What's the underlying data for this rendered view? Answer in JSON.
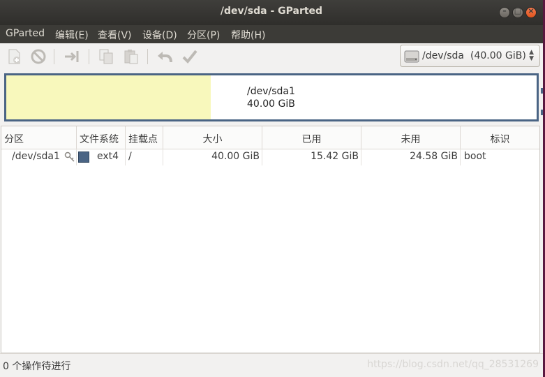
{
  "window": {
    "title": "/dev/sda - GParted"
  },
  "menubar": {
    "items": [
      {
        "label": "GParted"
      },
      {
        "label": "编辑(E)"
      },
      {
        "label": "查看(V)"
      },
      {
        "label": "设备(D)"
      },
      {
        "label": "分区(P)"
      },
      {
        "label": "帮助(H)"
      }
    ]
  },
  "toolbar": {
    "icons": [
      "new-partition-icon",
      "delete-icon",
      "resize-move-icon",
      "copy-icon",
      "paste-icon",
      "undo-icon",
      "apply-icon"
    ]
  },
  "device": {
    "path": "/dev/sda",
    "size": "(40.00 GiB)"
  },
  "diskmap": {
    "name": "/dev/sda1",
    "size": "40.00 GiB",
    "used_fraction": 0.386
  },
  "table": {
    "headers": [
      "分区",
      "文件系统",
      "挂载点",
      "大小",
      "已用",
      "未用",
      "标识"
    ],
    "rows": [
      {
        "partition": "/dev/sda1",
        "filesystem": "ext4",
        "mountpoint": "/",
        "size": "40.00 GiB",
        "used": "15.42 GiB",
        "unused": "24.58 GiB",
        "flags": "boot"
      }
    ]
  },
  "status": {
    "pending": "0 个操作待进行",
    "watermark": "https://blog.csdn.net/qq_28531269"
  },
  "colors": {
    "ext4": "#4a6484",
    "used": "#f8f8bc",
    "titlebar": "#3c3b37",
    "close_button": "#e95420"
  }
}
